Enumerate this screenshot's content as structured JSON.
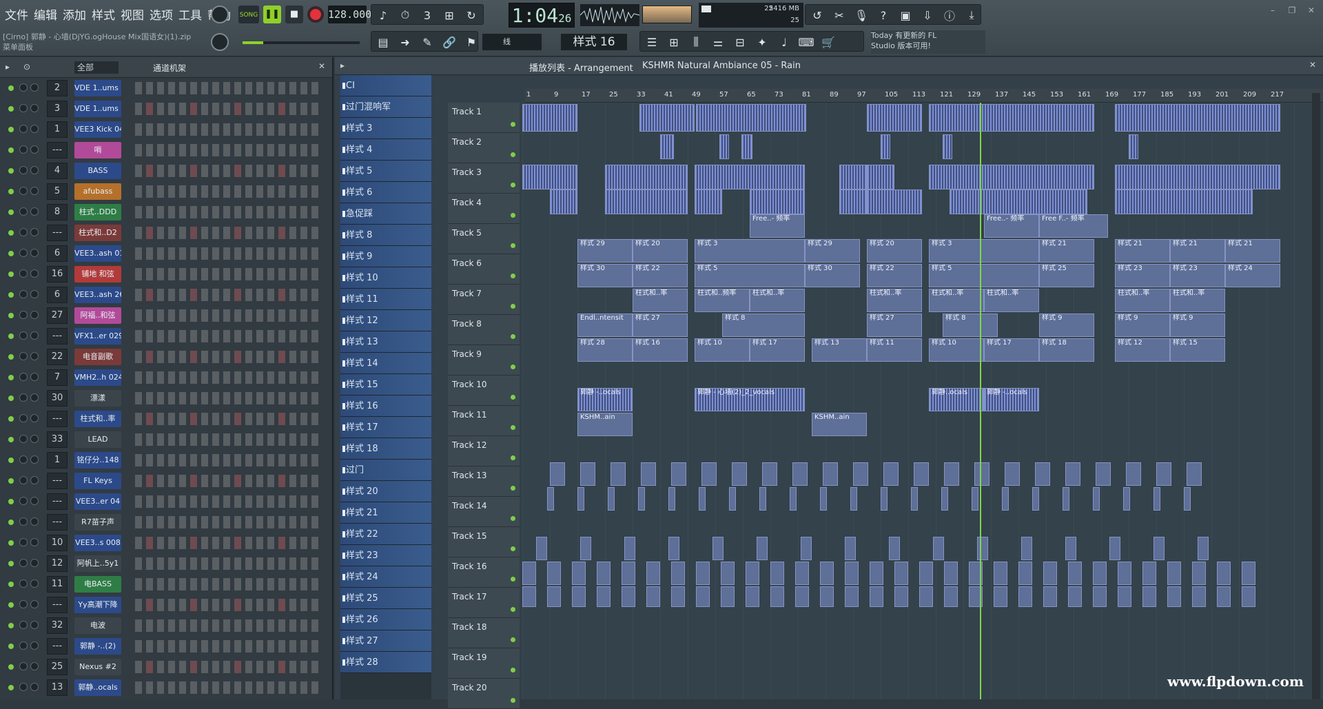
{
  "menu": [
    "文件",
    "编辑",
    "添加",
    "样式",
    "视图",
    "选项",
    "工具",
    "帮助"
  ],
  "hint": {
    "line1": "[Cirno] 郭静 - 心墙(DjYG.ogHouse Mix国语女)(1).zip",
    "line2": "菜单面板"
  },
  "transport": {
    "song_label": "SONG",
    "tempo": "128.000",
    "time": "1:04",
    "time_small": "26",
    "time_unit": "M:S:CS"
  },
  "cpu": {
    "mem": "5416 MB",
    "voices": "22",
    "poly": "25"
  },
  "pattern_selector": "样式 16",
  "snap": "线",
  "news": {
    "line1": "Today  有更新的 FL",
    "line2": "Studio 版本可用!"
  },
  "rack": {
    "filter": "全部",
    "title": "通道机架"
  },
  "channels": [
    {
      "num": "2",
      "name": "VDE 1..ums 1",
      "color": "#2c4a8a"
    },
    {
      "num": "3",
      "name": "VDE 1..ums 6",
      "color": "#2c4a8a"
    },
    {
      "num": "1",
      "name": "VEE3 Kick 04",
      "color": "#2c4a8a"
    },
    {
      "num": "---",
      "name": "哨",
      "color": "#b24a9a"
    },
    {
      "num": "4",
      "name": "BASS",
      "color": "#2c4a8a"
    },
    {
      "num": "5",
      "name": "afubass",
      "color": "#b5702b"
    },
    {
      "num": "8",
      "name": "柱式..DDD",
      "color": "#2f7d46"
    },
    {
      "num": "---",
      "name": "柱式和..D2",
      "color": "#7a3a3a"
    },
    {
      "num": "6",
      "name": "VEE3..ash 01",
      "color": "#2c4a8a"
    },
    {
      "num": "16",
      "name": "铺地 和弦",
      "color": "#b23a3a"
    },
    {
      "num": "6",
      "name": "VEE3..ash 26",
      "color": "#2c4a8a"
    },
    {
      "num": "27",
      "name": "阿福..和弦",
      "color": "#b24a9a"
    },
    {
      "num": "---",
      "name": "VFX1..er 029",
      "color": "#2c4a8a"
    },
    {
      "num": "22",
      "name": "电音副歌",
      "color": "#7a3a3a"
    },
    {
      "num": "7",
      "name": "VMH2..h 024",
      "color": "#2c4a8a"
    },
    {
      "num": "30",
      "name": "漂漾",
      "color": "#3b444a"
    },
    {
      "num": "---",
      "name": "柱式和..率",
      "color": "#2c4a8a"
    },
    {
      "num": "33",
      "name": "LEAD",
      "color": "#3b444a"
    },
    {
      "num": "1",
      "name": "铭仔分..148",
      "color": "#2c4a8a"
    },
    {
      "num": "---",
      "name": "FL Keys",
      "color": "#2c4a8a"
    },
    {
      "num": "---",
      "name": "VEE3..er 04",
      "color": "#2c4a8a"
    },
    {
      "num": "---",
      "name": "R7苗子声",
      "color": "#3b444a"
    },
    {
      "num": "10",
      "name": "VEE3..s 008",
      "color": "#2c4a8a"
    },
    {
      "num": "12",
      "name": "阿帆上..5y1",
      "color": "#3b444a"
    },
    {
      "num": "11",
      "name": "电BASS",
      "color": "#2f7d46"
    },
    {
      "num": "---",
      "name": "Yy高潮下降",
      "color": "#2c4a8a"
    },
    {
      "num": "32",
      "name": "电波",
      "color": "#3b444a"
    },
    {
      "num": "---",
      "name": "郭静 -..(2)",
      "color": "#2c4a8a"
    },
    {
      "num": "25",
      "name": "Nexus #2",
      "color": "#3b444a"
    },
    {
      "num": "13",
      "name": "郭静..ocals",
      "color": "#2c4a8a"
    }
  ],
  "playlist": {
    "title": "播放列表 - Arrangement",
    "breadcrumb": "KSHMR Natural Ambiance 05 - Rain"
  },
  "patterns": [
    "CI",
    "过门混响军",
    "样式 3",
    "样式 4",
    "样式 5",
    "样式 6",
    "急促踩",
    "样式 8",
    "样式 9",
    "样式 10",
    "样式 11",
    "样式 12",
    "样式 13",
    "样式 14",
    "样式 15",
    "样式 16",
    "样式 17",
    "样式 18",
    "过门",
    "样式 20",
    "样式 21",
    "样式 22",
    "样式 23",
    "样式 24",
    "样式 25",
    "样式 26",
    "样式 27",
    "样式 28"
  ],
  "ruler": [
    "1",
    "9",
    "17",
    "25",
    "33",
    "41",
    "49",
    "57",
    "65",
    "73",
    "81",
    "89",
    "97",
    "105",
    "113",
    "121",
    "129",
    "137",
    "145",
    "153",
    "161",
    "169",
    "177",
    "185",
    "193",
    "201",
    "209",
    "217"
  ],
  "tracks": [
    "Track 1",
    "Track 2",
    "Track 3",
    "Track 4",
    "Track 5",
    "Track 6",
    "Track 7",
    "Track 8",
    "Track 9",
    "Track 10",
    "Track 11",
    "Track 12",
    "Track 13",
    "Track 14",
    "Track 15",
    "Track 16",
    "Track 17",
    "Track 18",
    "Track 19",
    "Track 20"
  ],
  "clip_labels": {
    "t5": [
      "Free..- 频率",
      "Free..- 频率",
      "Free F..- 频率"
    ],
    "t6": [
      "样式 29",
      "样式 20",
      "样式 3",
      "样式 29",
      "样式 20",
      "样式 3",
      "样式 21",
      "样式 21",
      "样式 21",
      "样式 21"
    ],
    "t7": [
      "样式 30",
      "样式 22",
      "样式 5",
      "样式 30",
      "样式 22",
      "样式 5",
      "样式 25",
      "样式 23",
      "样式 23",
      "样式 24"
    ],
    "t8": [
      "柱式和..率",
      "柱式和..频率",
      "柱式和..率",
      "柱式和..率",
      "柱式和..率",
      "柱式和..率",
      "柱式和..率",
      "柱式和..率"
    ],
    "t9": [
      "Endl..ntensit",
      "样式 27",
      "样式 8",
      "样式 27",
      "样式 8",
      "样式 9",
      "样式 9",
      "样式 9"
    ],
    "t10": [
      "样式 28",
      "样式 16",
      "样式 10",
      "样式 17",
      "样式 13",
      "样式 11",
      "样式 10",
      "样式 17",
      "样式 18",
      "样式 12",
      "样式 15"
    ],
    "t12": [
      "郭静 -..ocals",
      "郭静 - 心墙(2)_2_vocals",
      "郭静..ocals",
      "郭静 -..ocals"
    ],
    "t13": [
      "KSHM..ain",
      "KSHM..ain"
    ]
  },
  "watermark": "www.flpdown.com"
}
